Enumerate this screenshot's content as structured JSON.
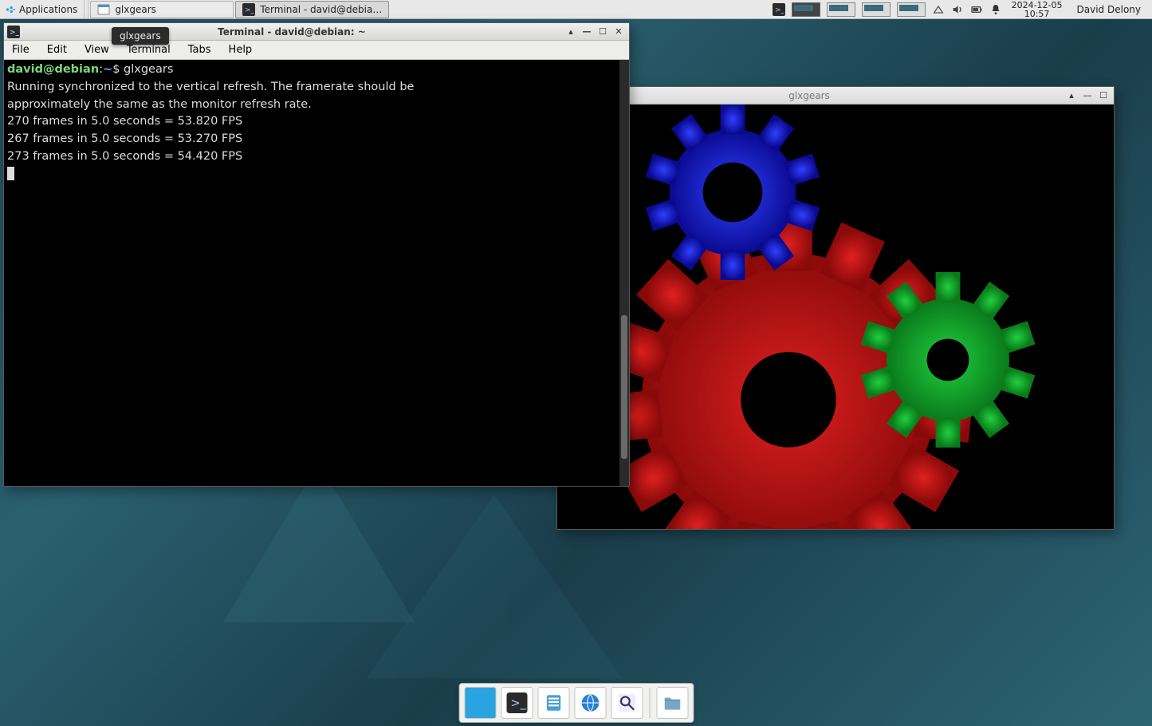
{
  "panel": {
    "applications_label": "Applications",
    "tasks": [
      {
        "label": "glxgears",
        "active": false,
        "icon": "window"
      },
      {
        "label": "Terminal - david@debia…",
        "active": true,
        "icon": "terminal"
      }
    ],
    "clock_date": "2024-12-05",
    "clock_time": "10:57",
    "user_name": "David Delony"
  },
  "tooltip": {
    "text": "glxgears"
  },
  "terminal_window": {
    "title": "Terminal - david@debian: ~",
    "menus": [
      "File",
      "Edit",
      "View",
      "Terminal",
      "Tabs",
      "Help"
    ],
    "prompt": {
      "user": "david",
      "host": "debian",
      "path": "~",
      "symbol": "$"
    },
    "command": "glxgears",
    "output_lines": [
      "Running synchronized to the vertical refresh.  The framerate should be",
      "approximately the same as the monitor refresh rate.",
      "270 frames in 5.0 seconds = 53.820 FPS",
      "267 frames in 5.0 seconds = 53.270 FPS",
      "273 frames in 5.0 seconds = 54.420 FPS"
    ]
  },
  "glxgears_window": {
    "title": "glxgears",
    "gears": {
      "blue": "#1420d0",
      "red": "#c01010",
      "green": "#10b020"
    }
  },
  "dock": {
    "items": [
      {
        "name": "show-desktop",
        "active": true
      },
      {
        "name": "terminal"
      },
      {
        "name": "file-manager"
      },
      {
        "name": "web-browser"
      },
      {
        "name": "app-finder"
      }
    ],
    "after_sep": [
      {
        "name": "folder"
      }
    ]
  }
}
